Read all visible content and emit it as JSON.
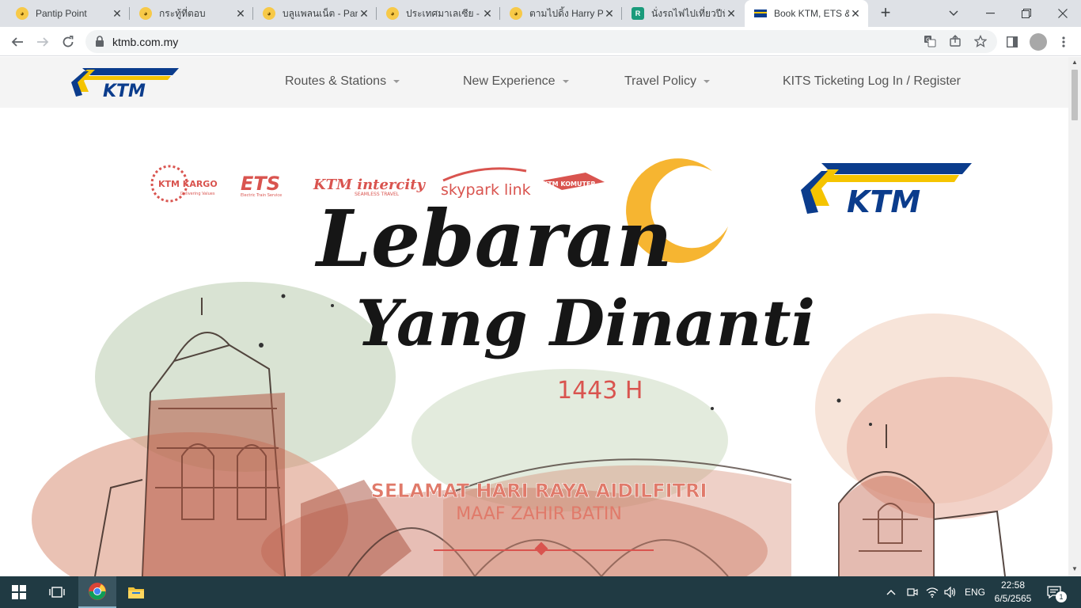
{
  "browser": {
    "tabs": [
      {
        "title": "Pantip Point",
        "active": false
      },
      {
        "title": "กระทู้ที่ตอบ",
        "active": false
      },
      {
        "title": "บลูแพลนเน็ต - Pant",
        "active": false
      },
      {
        "title": "ประเทศมาเลเซีย - P",
        "active": false
      },
      {
        "title": "ตามไปดิ้ง Harry Po",
        "active": false
      },
      {
        "title": "นั่งรถไฟไปเที่ยวปีนัง",
        "active": false
      },
      {
        "title": "Book KTM, ETS &",
        "active": true
      }
    ],
    "new_tab": "+",
    "url": "ktmb.com.my"
  },
  "site": {
    "logo_text": "KTM",
    "nav": [
      {
        "label": "Routes & Stations",
        "dropdown": true
      },
      {
        "label": "New Experience",
        "dropdown": true
      },
      {
        "label": "Travel Policy",
        "dropdown": true
      },
      {
        "label": "KITS Ticketing Log In / Register",
        "dropdown": false
      }
    ]
  },
  "banner": {
    "service_logos": [
      "KTM KARGO",
      "ETS",
      "KTM intercity",
      "skypark link",
      "KTM KOMUTER"
    ],
    "kargo_sub": "Delivering Values",
    "ets_sub": "Electric Train Service",
    "intercity_sub": "SEAMLESS TRAVEL",
    "brand_logo": "KTM",
    "headline_1": "Lebaran",
    "headline_2": "Yang Dinanti",
    "year": "1443 H",
    "greeting_1": "SELAMAT HARI RAYA AIDILFITRI",
    "greeting_2": "MAAF ZAHIR BATIN"
  },
  "taskbar": {
    "lang": "ENG",
    "time": "22:58",
    "date": "6/5/2565",
    "notification_count": "1"
  },
  "colors": {
    "ktm_blue": "#0b3c8c",
    "ktm_yellow": "#f5c400",
    "banner_red": "#d9544f",
    "greeting_coral": "#e07a6a",
    "taskbar": "#203a43"
  }
}
